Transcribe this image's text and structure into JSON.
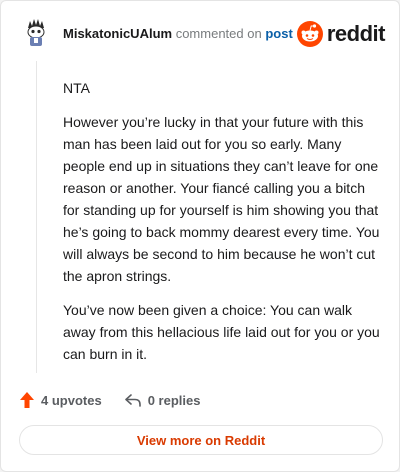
{
  "header": {
    "username": "MiskatonicUAlum",
    "action_text": "commented on",
    "post_link": "post",
    "logo_text": "reddit"
  },
  "comment": {
    "paragraphs": [
      "NTA",
      "However you’re lucky in that your future with this man has been laid out for you so early. Many people end up in situations they can’t leave for one reason or another. Your fiancé calling you a bitch for standing up for yourself is him showing you that he’s going to back mommy dearest every time. You will always be second to him because he won’t cut the apron strings.",
      "You’ve now been given a choice: You can walk away from this hellacious life laid out for you or you can burn in it."
    ]
  },
  "footer": {
    "upvotes": "4 upvotes",
    "replies": "0 replies"
  },
  "view_more_label": "View more on Reddit",
  "icons": {
    "upvote": "upvote-arrow-icon",
    "reply": "reply-arrow-icon",
    "logo": "reddit-snoo-icon",
    "avatar": "user-avatar"
  },
  "colors": {
    "accent": "#ff4500",
    "link": "#0a5fa8",
    "view_more": "#d93a00"
  }
}
